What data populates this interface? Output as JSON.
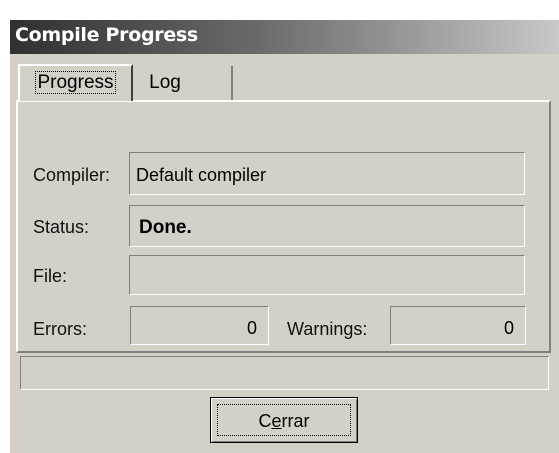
{
  "window": {
    "title": "Compile Progress"
  },
  "tabs": [
    {
      "label": "Progress",
      "active": true
    },
    {
      "label": "Log",
      "active": false
    }
  ],
  "progress": {
    "compiler_label": "Compiler:",
    "compiler_value": "Default compiler",
    "status_label": "Status:",
    "status_value": "Done.",
    "file_label": "File:",
    "file_value": "",
    "errors_label": "Errors:",
    "errors_value": "0",
    "warnings_label": "Warnings:",
    "warnings_value": "0"
  },
  "statusbar": {
    "text": ""
  },
  "close_button": {
    "label_prefix": "C",
    "label_mnemonic": "e",
    "label_suffix": "rrar"
  }
}
